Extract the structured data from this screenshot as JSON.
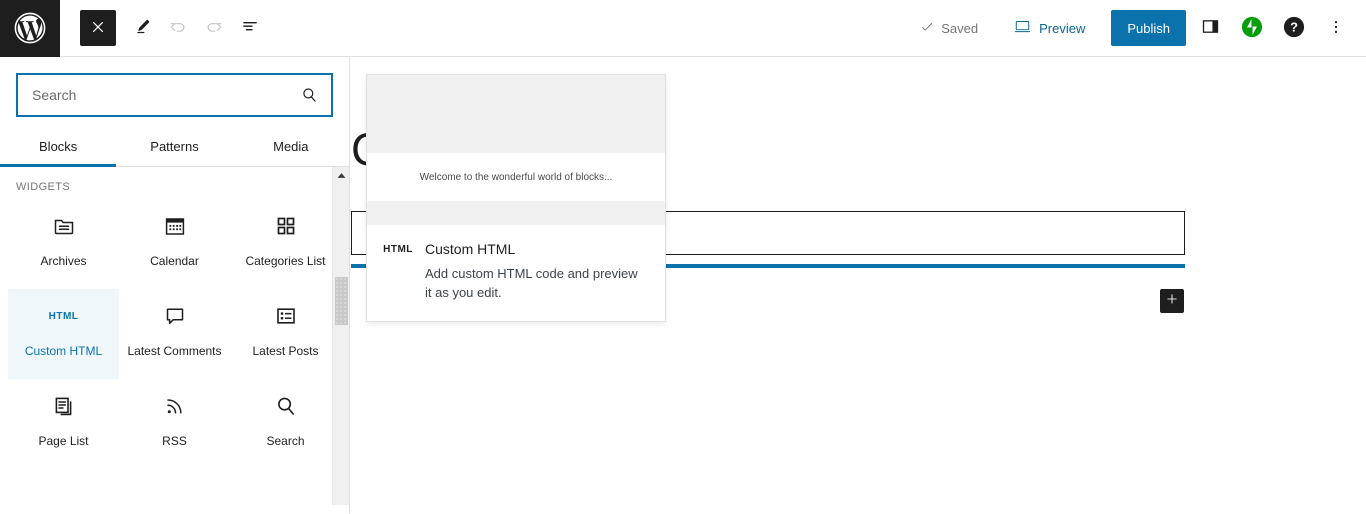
{
  "header": {
    "logo_icon": "wordpress-logo-icon",
    "close_icon": "close-x-icon",
    "close_label": "Close",
    "edit_icon": "pencil-edit-icon",
    "undo_icon": "undo-arrow-icon",
    "redo_icon": "redo-arrow-icon",
    "list_view_icon": "list-view-icon",
    "saved_label": "Saved",
    "saved_check_icon": "checkmark-icon",
    "preview_label": "Preview",
    "preview_icon": "desktop-monitor-icon",
    "publish_label": "Publish",
    "settings_icon": "sidebar-panel-icon",
    "jetpack_icon": "jetpack-bolt-icon",
    "help_icon": "help-question-icon",
    "more_icon": "more-vertical-dots-icon"
  },
  "inserter": {
    "search": {
      "value": "",
      "placeholder": "Search",
      "icon": "search-magnifier-icon"
    },
    "tabs": [
      {
        "label": "Blocks",
        "active": true
      },
      {
        "label": "Patterns",
        "active": false
      },
      {
        "label": "Media",
        "active": false
      }
    ],
    "category_label": "WIDGETS",
    "blocks": [
      {
        "label": "Archives",
        "icon": "archive-folder-icon",
        "selected": false
      },
      {
        "label": "Calendar",
        "icon": "calendar-icon",
        "selected": false
      },
      {
        "label": "Categories List",
        "icon": "grid-squares-icon",
        "selected": false
      },
      {
        "label": "Custom HTML",
        "icon": "html-text-icon",
        "selected": true
      },
      {
        "label": "Latest Comments",
        "icon": "comment-bubble-icon",
        "selected": false
      },
      {
        "label": "Latest Posts",
        "icon": "list-box-icon",
        "selected": false
      },
      {
        "label": "Page List",
        "icon": "pages-stack-icon",
        "selected": false
      },
      {
        "label": "RSS",
        "icon": "rss-feed-icon",
        "selected": false
      },
      {
        "label": "Search",
        "icon": "search-magnifier-icon",
        "selected": false
      }
    ],
    "scrollbar": {
      "up_arrow_icon": "scroll-up-arrow-icon"
    }
  },
  "block_preview": {
    "preview_text": "Welcome to the wonderful world of blocks...",
    "icon": "html-text-icon",
    "title": "Custom HTML",
    "description": "Add custom HTML code and preview it as you edit."
  },
  "canvas": {
    "post_title": "Contact Us",
    "empty_block_placeholder": "",
    "plus_icon": "plus-add-block-icon"
  },
  "colors": {
    "accent_blue": "#0b72ab",
    "dark": "#1e1e1e",
    "jetpack_green": "#069e08",
    "selected_bg": "#f0f7fb"
  }
}
